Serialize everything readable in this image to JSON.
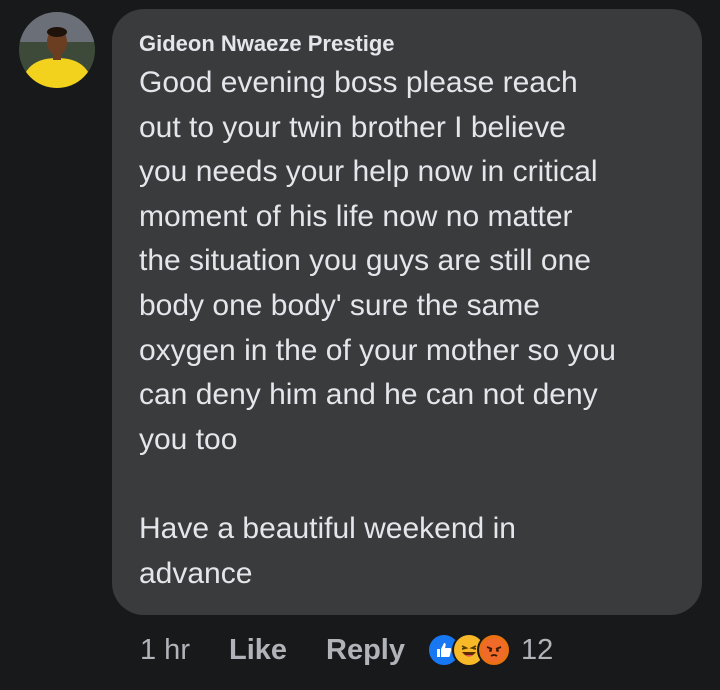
{
  "comment": {
    "author": "Gideon Nwaeze Prestige",
    "lines": [
      "Good evening boss  please reach",
      "out to your twin brother I believe",
      "you needs your help now in critical",
      "moment of his life now no matter",
      "the situation you guys are still one",
      "body one body' sure the same",
      "oxygen in the of your mother so you",
      "can deny him and he can not deny",
      "you too",
      "",
      "Have a beautiful weekend in",
      "advance"
    ]
  },
  "actions": {
    "time": "1 hr",
    "like_label": "Like",
    "reply_label": "Reply",
    "reaction_count": "12",
    "reactions": [
      "like-icon",
      "haha-icon",
      "angry-icon"
    ]
  },
  "colors": {
    "background": "#18191a",
    "bubble": "#3a3b3c",
    "text": "#e4e6eb",
    "muted": "#b0b3b8",
    "like_blue": "#1877f2"
  }
}
